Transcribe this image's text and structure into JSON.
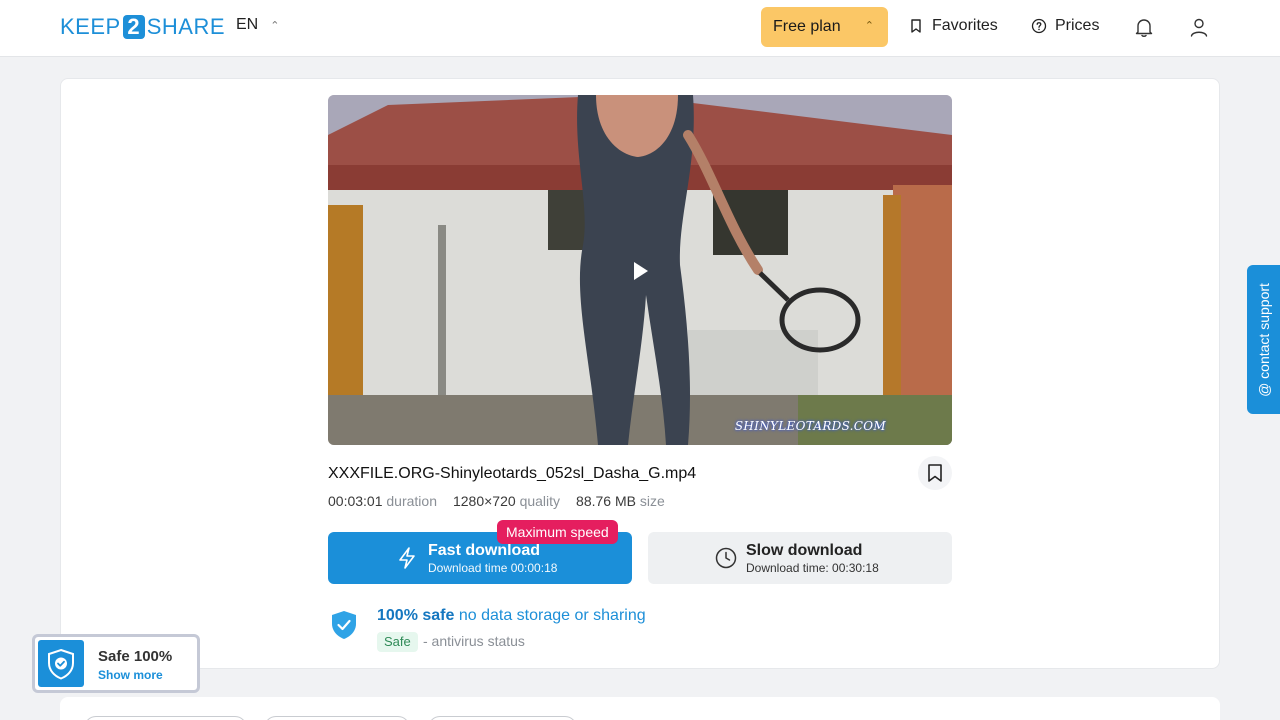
{
  "header": {
    "logo_left": "KEEP",
    "logo_mid": "2",
    "logo_right": "SHARE",
    "lang": "EN",
    "plan": "Free plan",
    "favorites": "Favorites",
    "prices": "Prices"
  },
  "video": {
    "watermark": "SHINYLEOTARDS.COM"
  },
  "file": {
    "name": "XXXFILE.ORG-Shinyleotards_052sl_Dasha_G.mp4",
    "duration": "00:03:01",
    "duration_label": "duration",
    "quality": "1280×720",
    "quality_label": "quality",
    "size": "88.76 MB",
    "size_label": "size"
  },
  "download": {
    "badge": "Maximum speed",
    "fast_title": "Fast download",
    "fast_time": "Download time 00:00:18",
    "slow_title": "Slow download",
    "slow_time": "Download time: 00:30:18"
  },
  "safety": {
    "headline_bold": "100% safe",
    "headline_rest": " no data storage or sharing",
    "tag": "Safe",
    "status": "- antivirus status"
  },
  "support": {
    "label": "@ contact support"
  },
  "widget": {
    "title": "Safe 100%",
    "link": "Show more"
  },
  "colors": {
    "brand": "#1b8fd9",
    "plan": "#fbc766",
    "badge": "#e51e5f"
  }
}
